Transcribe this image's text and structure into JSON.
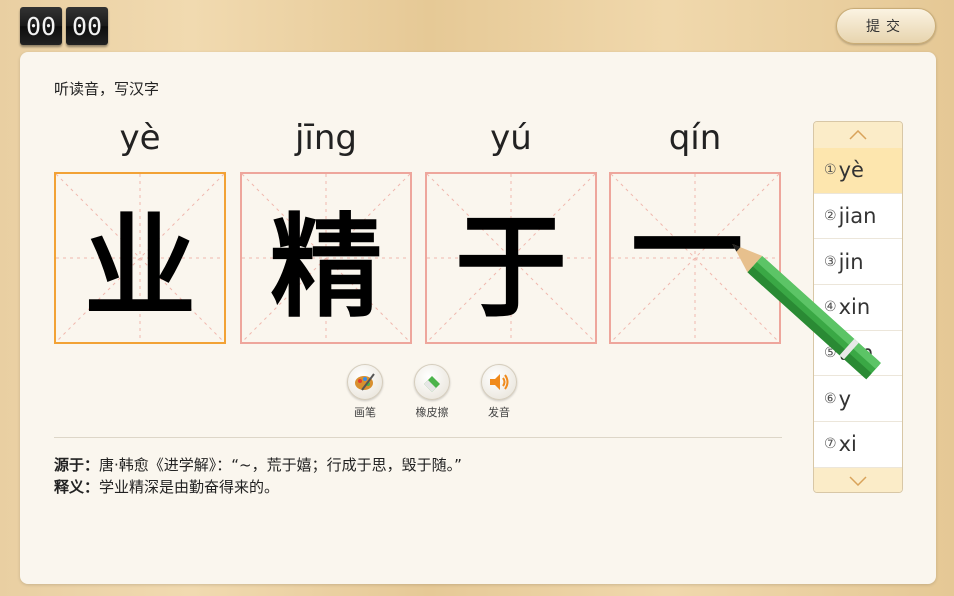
{
  "timer": {
    "minutes": "00",
    "seconds": "00"
  },
  "submit_label": "提交",
  "instruction": "听读音，写汉字",
  "tiles": [
    {
      "pinyin": "yè",
      "char": "业"
    },
    {
      "pinyin": "jīng",
      "char": "精"
    },
    {
      "pinyin": "yú",
      "char": "于"
    },
    {
      "pinyin": "qín",
      "char": "一"
    }
  ],
  "tools": {
    "brush": "画笔",
    "eraser": "橡皮擦",
    "sound": "发音"
  },
  "source": {
    "label": "源于：",
    "text": "唐·韩愈《进学解》：“~，荒于嬉；行成于思，毁于随。”",
    "meaning_label": "释义：",
    "meaning": "学业精深是由勤奋得来的。"
  },
  "candidates": [
    {
      "num": "①",
      "text": "yè"
    },
    {
      "num": "②",
      "text": "jian"
    },
    {
      "num": "③",
      "text": "jin"
    },
    {
      "num": "④",
      "text": "xin"
    },
    {
      "num": "⑤",
      "text": "tun"
    },
    {
      "num": "⑥",
      "text": "y"
    },
    {
      "num": "⑦",
      "text": "xi"
    }
  ],
  "colors": {
    "active_border": "#f2a235",
    "cell_border": "#eea69c",
    "selected_option": "#fde6ae",
    "pencil": "#3aa845"
  }
}
